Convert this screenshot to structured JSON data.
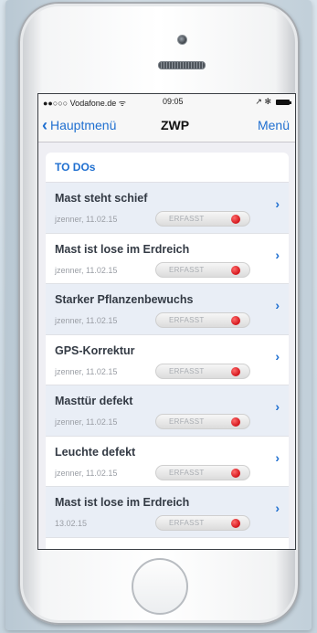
{
  "status_bar": {
    "carrier": "●●○○○ Vodafone.de",
    "wifi_icon": "wifi-icon",
    "time": "09:05",
    "right_icons": "↗ ✻"
  },
  "nav": {
    "back_label": "Hauptmenü",
    "title": "ZWP",
    "menu_label": "Menü"
  },
  "section": {
    "header": "TO DOs"
  },
  "todos": [
    {
      "title": "Mast steht schief",
      "meta": "jzenner, 11.02.15",
      "status": "ERFASST"
    },
    {
      "title": "Mast ist lose im Erdreich",
      "meta": "jzenner, 11.02.15",
      "status": "ERFASST"
    },
    {
      "title": "Starker Pflanzenbewuchs",
      "meta": "jzenner, 11.02.15",
      "status": "ERFASST"
    },
    {
      "title": "GPS-Korrektur",
      "meta": "jzenner, 11.02.15",
      "status": "ERFASST"
    },
    {
      "title": "Masttür defekt",
      "meta": "jzenner, 11.02.15",
      "status": "ERFASST"
    },
    {
      "title": "Leuchte defekt",
      "meta": "jzenner, 11.02.15",
      "status": "ERFASST"
    },
    {
      "title": "Mast ist lose im Erdreich",
      "meta": "13.02.15",
      "status": "ERFASST"
    }
  ],
  "colors": {
    "accent": "#1f6fd0",
    "status_dot": "#d2141a"
  }
}
